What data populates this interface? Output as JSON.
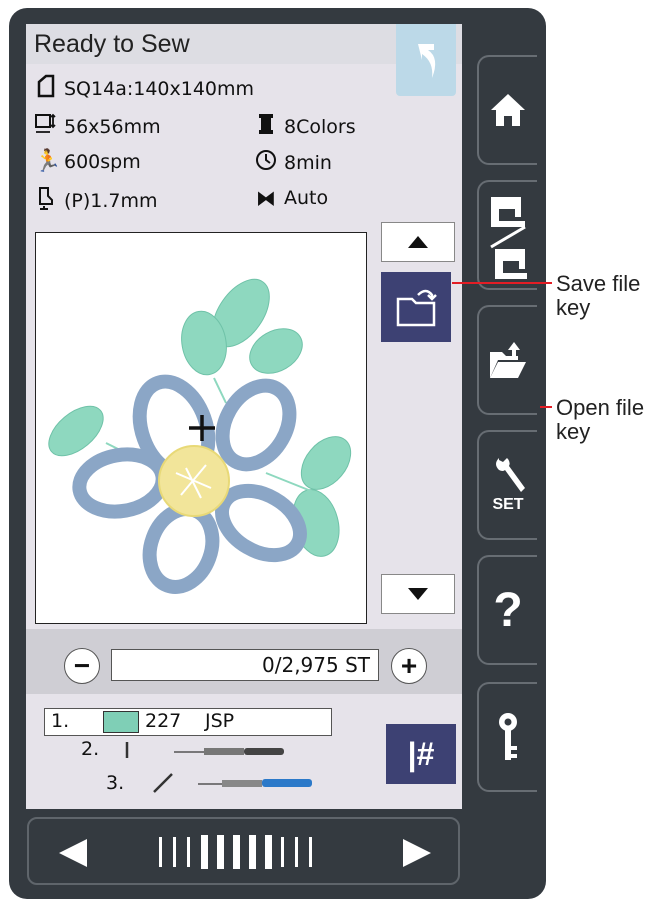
{
  "screen": {
    "title": "Ready to Sew",
    "hoop": "SQ14a:140x140mm",
    "size": "56x56mm",
    "colors": "8Colors",
    "speed": "600spm",
    "time": "8min",
    "presser": "(P)1.7mm",
    "tension": "Auto"
  },
  "stitch": {
    "counter": "0/2,975 ST"
  },
  "color_list": [
    {
      "index": "1.",
      "swatch_color": "#7fcfb6",
      "code": "227",
      "brand": "JSP"
    },
    {
      "index": "2."
    },
    {
      "index": "3."
    }
  ],
  "callouts": {
    "save": "Save file\nkey",
    "open": "Open file\nkey"
  },
  "colors_ui": {
    "key_bg": "#3d4173",
    "device_bg": "#343a40",
    "accent_line": "#e31d25"
  }
}
